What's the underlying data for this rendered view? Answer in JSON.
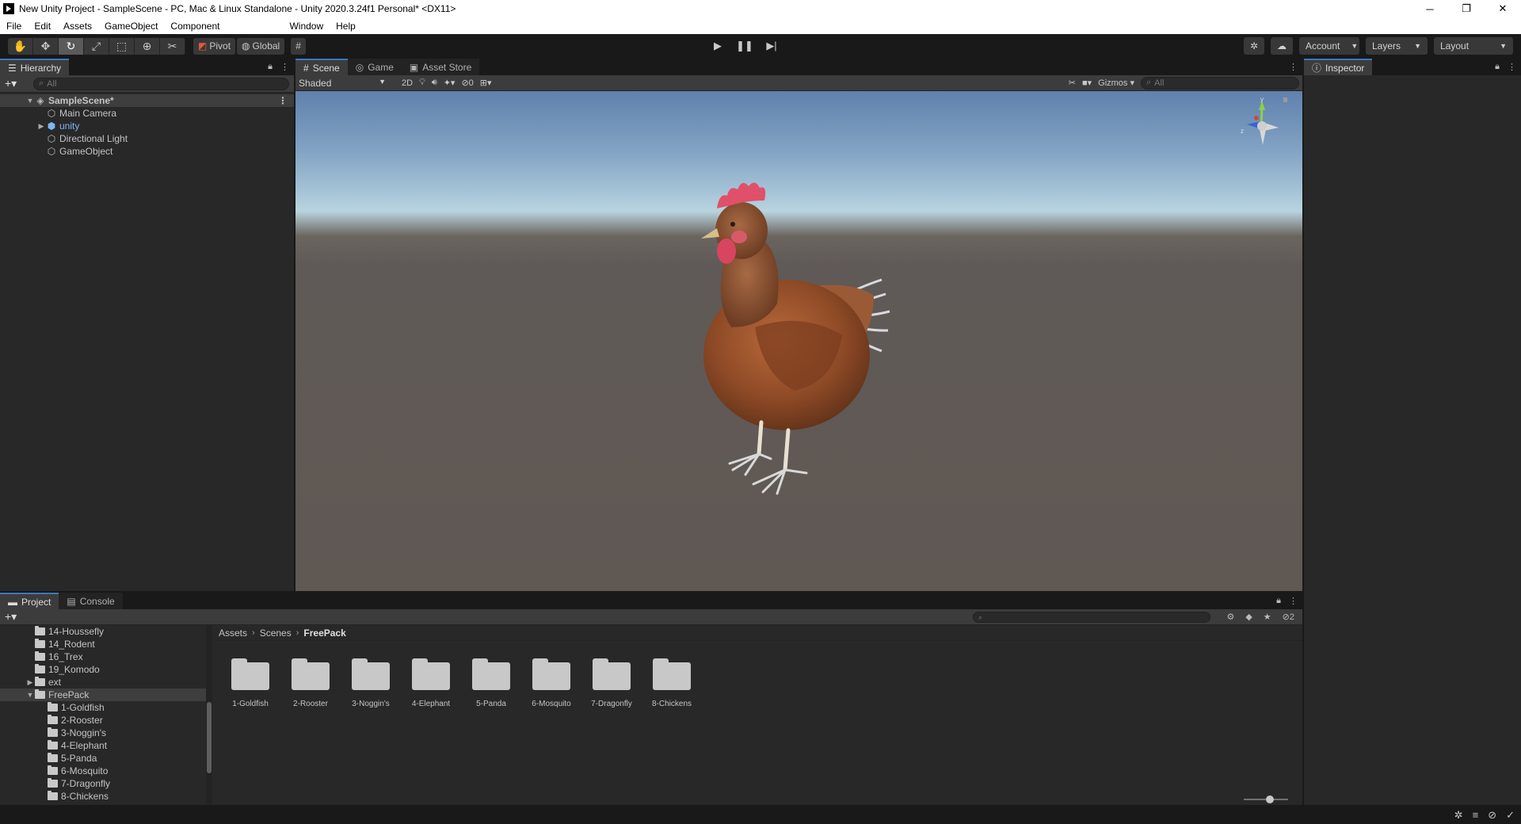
{
  "window": {
    "title": "New Unity Project - SampleScene - PC, Mac & Linux Standalone - Unity 2020.3.24f1 Personal* <DX11>",
    "controls": [
      "─",
      "❐",
      "✕"
    ]
  },
  "menu": [
    "File",
    "Edit",
    "Assets",
    "GameObject",
    "Component",
    "Window",
    "Help"
  ],
  "toolbar": {
    "pivot_label": "Pivot",
    "global_label": "Global",
    "account_label": "Account",
    "layers_label": "Layers",
    "layout_label": "Layout"
  },
  "hierarchy": {
    "tab_label": "Hierarchy",
    "search_placeholder": "All",
    "scene_name": "SampleScene*",
    "items": [
      "Main Camera",
      "unity",
      "Directional Light",
      "GameObject"
    ]
  },
  "scene": {
    "tabs": [
      "Scene",
      "Game",
      "Asset Store"
    ],
    "shading_mode": "Shaded",
    "mode_2d": "2D",
    "hidden_count": "0",
    "gizmos_label": "Gizmos",
    "search_placeholder": "All",
    "axis_labels": {
      "y": "y",
      "z": "z"
    }
  },
  "inspector": {
    "tab_label": "Inspector"
  },
  "project": {
    "tabs": [
      "Project",
      "Console"
    ],
    "hidden_count": "2",
    "folder_tree": [
      "14-Houssefly",
      "14_Rodent",
      "16_Trex",
      "19_Komodo",
      "ext",
      "FreePack",
      "1-Goldfish",
      "2-Rooster",
      "3-Noggin's",
      "4-Elephant",
      "5-Panda",
      "6-Mosquito",
      "7-Dragonfly",
      "8-Chickens"
    ],
    "breadcrumb": [
      "Assets",
      "Scenes",
      "FreePack"
    ],
    "assets": [
      "1-Goldfish",
      "2-Rooster",
      "3-Noggin's",
      "4-Elephant",
      "5-Panda",
      "6-Mosquito",
      "7-Dragonfly",
      "8-Chickens"
    ]
  },
  "colors": {
    "editor_bg": "#282828",
    "tab_active_accent": "#3a79bb",
    "prefab_text": "#7eb6f2"
  }
}
